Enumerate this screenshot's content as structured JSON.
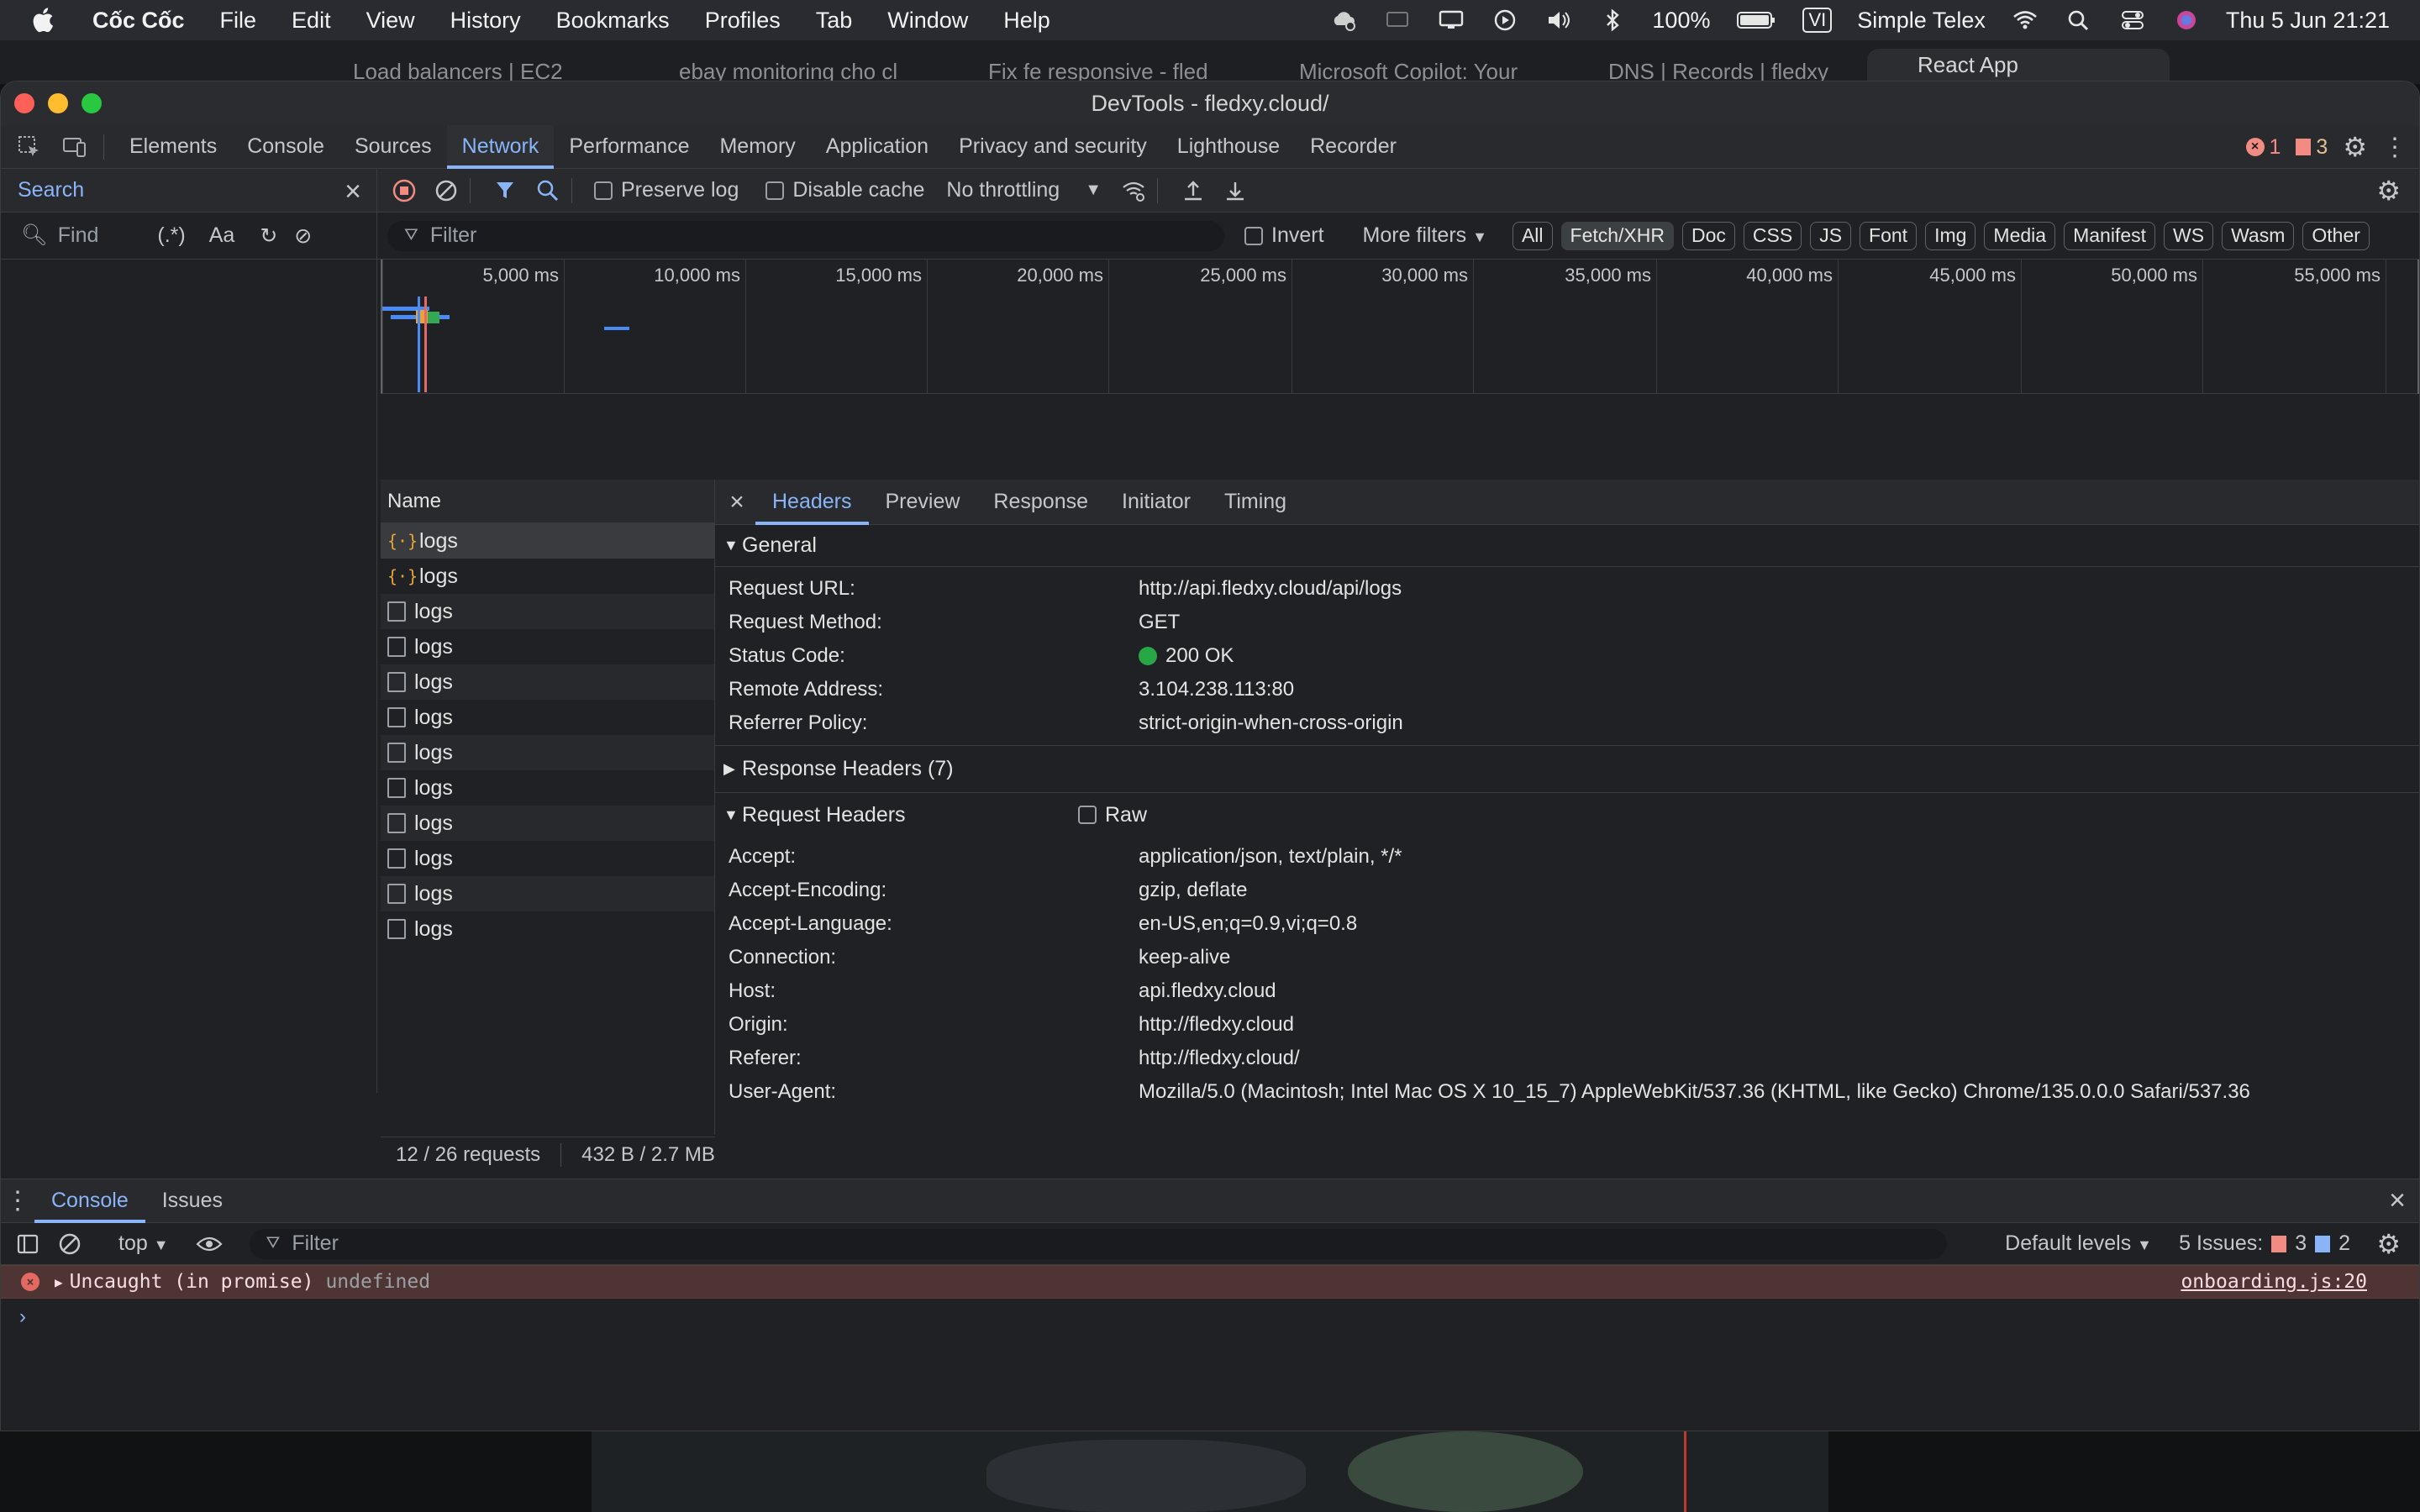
{
  "menubar": {
    "app_name": "Cốc Cốc",
    "items": [
      "File",
      "Edit",
      "View",
      "History",
      "Bookmarks",
      "Profiles",
      "Tab",
      "Window",
      "Help"
    ],
    "battery": "100%",
    "input_method_badge": "VI",
    "input_method": "Simple Telex",
    "datetime": "Thu 5 Jun  21:21"
  },
  "browser_tabs": [
    "Load balancers | EC2",
    "ebay monitoring cho cl",
    "Fix fe responsive - fled",
    "Microsoft Copilot: Your",
    "DNS | Records | fledxy",
    "React App"
  ],
  "window": {
    "title": "DevTools - fledxy.cloud/"
  },
  "main_tabs": [
    "Elements",
    "Console",
    "Sources",
    "Network",
    "Performance",
    "Memory",
    "Application",
    "Privacy and security",
    "Lighthouse",
    "Recorder"
  ],
  "main_tabs_active": "Network",
  "issue_counts": {
    "errors": "1",
    "warnings": "3"
  },
  "search_panel": {
    "title": "Search",
    "find_placeholder": "Find",
    "regex_label": "(.*)",
    "case_label": "Aa"
  },
  "network_toolbar": {
    "preserve_log": "Preserve log",
    "disable_cache": "Disable cache",
    "throttling": "No throttling"
  },
  "filter_bar": {
    "placeholder": "Filter",
    "invert": "Invert",
    "more_filters": "More filters",
    "chips": [
      "All",
      "Fetch/XHR",
      "Doc",
      "CSS",
      "JS",
      "Font",
      "Img",
      "Media",
      "Manifest",
      "WS",
      "Wasm",
      "Other"
    ],
    "active_chip": "Fetch/XHR"
  },
  "timeline": {
    "ticks": [
      "5,000 ms",
      "10,000 ms",
      "15,000 ms",
      "20,000 ms",
      "25,000 ms",
      "30,000 ms",
      "35,000 ms",
      "40,000 ms",
      "45,000 ms",
      "50,000 ms",
      "55,000 ms"
    ]
  },
  "requests": {
    "column_name": "Name",
    "rows": [
      {
        "name": "logs",
        "type": "xhr"
      },
      {
        "name": "logs",
        "type": "xhr"
      },
      {
        "name": "logs",
        "type": "doc"
      },
      {
        "name": "logs",
        "type": "doc"
      },
      {
        "name": "logs",
        "type": "doc"
      },
      {
        "name": "logs",
        "type": "doc"
      },
      {
        "name": "logs",
        "type": "doc"
      },
      {
        "name": "logs",
        "type": "doc"
      },
      {
        "name": "logs",
        "type": "doc"
      },
      {
        "name": "logs",
        "type": "doc"
      },
      {
        "name": "logs",
        "type": "doc"
      },
      {
        "name": "logs",
        "type": "doc"
      }
    ],
    "status_count": "12 / 26 requests",
    "status_size": "432 B / 2.7 MB"
  },
  "details": {
    "tabs": [
      "Headers",
      "Preview",
      "Response",
      "Initiator",
      "Timing"
    ],
    "active_tab": "Headers",
    "general": {
      "title": "General",
      "rows": [
        {
          "k": "Request URL:",
          "v": "http://api.fledxy.cloud/api/logs"
        },
        {
          "k": "Request Method:",
          "v": "GET"
        },
        {
          "k": "Status Code:",
          "v": "200 OK"
        },
        {
          "k": "Remote Address:",
          "v": "3.104.238.113:80"
        },
        {
          "k": "Referrer Policy:",
          "v": "strict-origin-when-cross-origin"
        }
      ]
    },
    "response_headers_title": "Response Headers (7)",
    "request_headers": {
      "title": "Request Headers",
      "raw_label": "Raw",
      "rows": [
        {
          "k": "Accept:",
          "v": "application/json, text/plain, */*"
        },
        {
          "k": "Accept-Encoding:",
          "v": "gzip, deflate"
        },
        {
          "k": "Accept-Language:",
          "v": "en-US,en;q=0.9,vi;q=0.8"
        },
        {
          "k": "Connection:",
          "v": "keep-alive"
        },
        {
          "k": "Host:",
          "v": "api.fledxy.cloud"
        },
        {
          "k": "Origin:",
          "v": "http://fledxy.cloud"
        },
        {
          "k": "Referer:",
          "v": "http://fledxy.cloud/"
        },
        {
          "k": "User-Agent:",
          "v": "Mozilla/5.0 (Macintosh; Intel Mac OS X 10_15_7) AppleWebKit/537.36 (KHTML, like Gecko) Chrome/135.0.0.0 Safari/537.36"
        }
      ]
    }
  },
  "drawer": {
    "tabs": [
      "Console",
      "Issues"
    ],
    "active_tab": "Console",
    "context": "top",
    "filter_placeholder": "Filter",
    "levels": "Default levels",
    "issues_label": "5 Issues:",
    "issues_errors": "3",
    "issues_info": "2",
    "error_message": "Uncaught (in promise)",
    "error_value": "undefined",
    "error_source": "onboarding.js:20"
  },
  "colors": {
    "accent": "#8ab4f8",
    "error": "#f28b82",
    "success": "#28a745",
    "panel_bg": "#202124"
  }
}
